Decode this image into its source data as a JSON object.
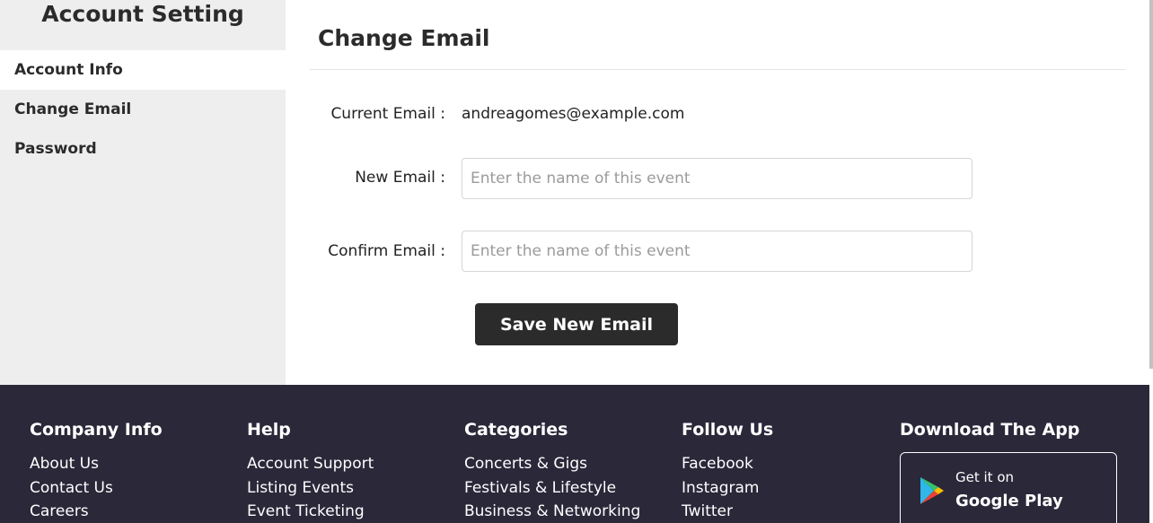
{
  "sidebar": {
    "title": "Account Setting",
    "items": [
      {
        "label": "Account Info"
      },
      {
        "label": "Change Email"
      },
      {
        "label": "Password"
      }
    ]
  },
  "main": {
    "title": "Change Email",
    "current_email_label": "Current Email :",
    "current_email_value": "andreagomes@example.com",
    "new_email_label": "New Email :",
    "new_email_placeholder": "Enter the name of this event",
    "confirm_email_label": "Confirm Email :",
    "confirm_email_placeholder": "Enter the name of this event",
    "save_label": "Save New Email"
  },
  "footer": {
    "company": {
      "heading": "Company Info",
      "links": [
        "About Us",
        "Contact Us",
        "Careers"
      ]
    },
    "help": {
      "heading": "Help",
      "links": [
        "Account Support",
        "Listing Events",
        "Event Ticketing"
      ]
    },
    "categories": {
      "heading": "Categories",
      "links": [
        "Concerts & Gigs",
        "Festivals & Lifestyle",
        "Business & Networking"
      ]
    },
    "follow": {
      "heading": "Follow Us",
      "links": [
        "Facebook",
        "Instagram",
        "Twitter"
      ]
    },
    "app": {
      "heading": "Download The App",
      "badge_small": "Get it on",
      "badge_big": "Google Play"
    }
  },
  "colors": {
    "sidebar_bg": "#eeeeee",
    "footer_bg": "#2a2839",
    "button_bg": "#2b2b2b"
  },
  "icons": {
    "store_badge": "google-play-icon"
  }
}
